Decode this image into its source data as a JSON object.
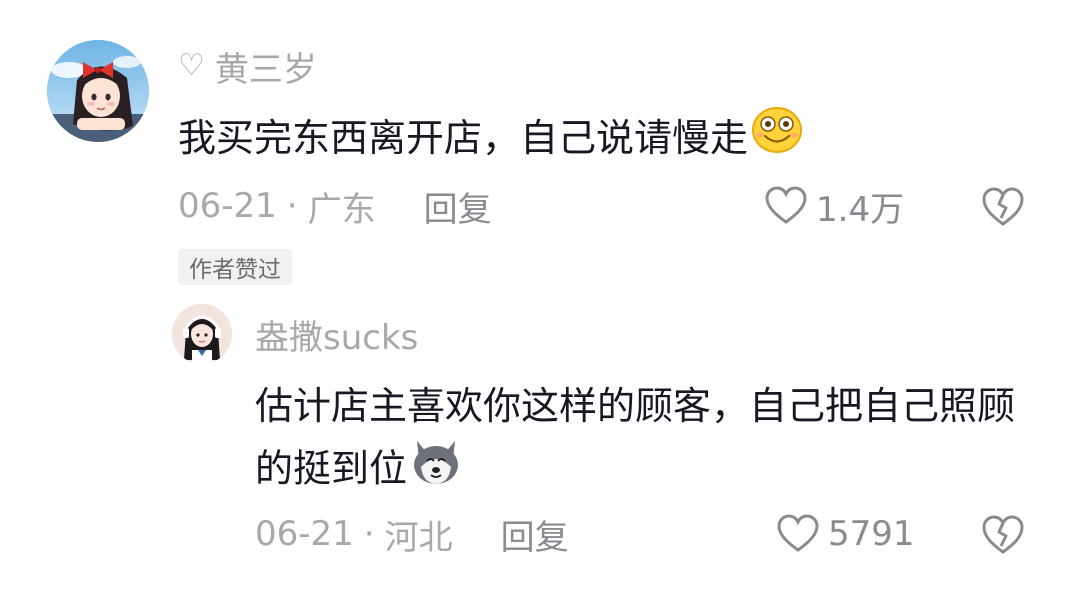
{
  "main_comment": {
    "username": "黄三岁",
    "text": "我买完东西离开店，自己说请慢走",
    "emoji_icon": "grinning-face-emoji",
    "date": "06-21",
    "separator": "·",
    "location": "广东",
    "reply_label": "回复",
    "like_count": "1.4万",
    "author_liked_badge": "作者赞过"
  },
  "reply_comment": {
    "username": "盎撒sucks",
    "text": "估计店主喜欢你这样的顾客，自己把自己照顾的挺到位",
    "emoji_icon": "husky-dog-emoji",
    "date": "06-21",
    "separator": "·",
    "location": "河北",
    "reply_label": "回复",
    "like_count": "5791"
  },
  "colors": {
    "text_primary": "#161823",
    "text_secondary": "#a7a8ac",
    "badge_bg": "#f1f1f2"
  }
}
